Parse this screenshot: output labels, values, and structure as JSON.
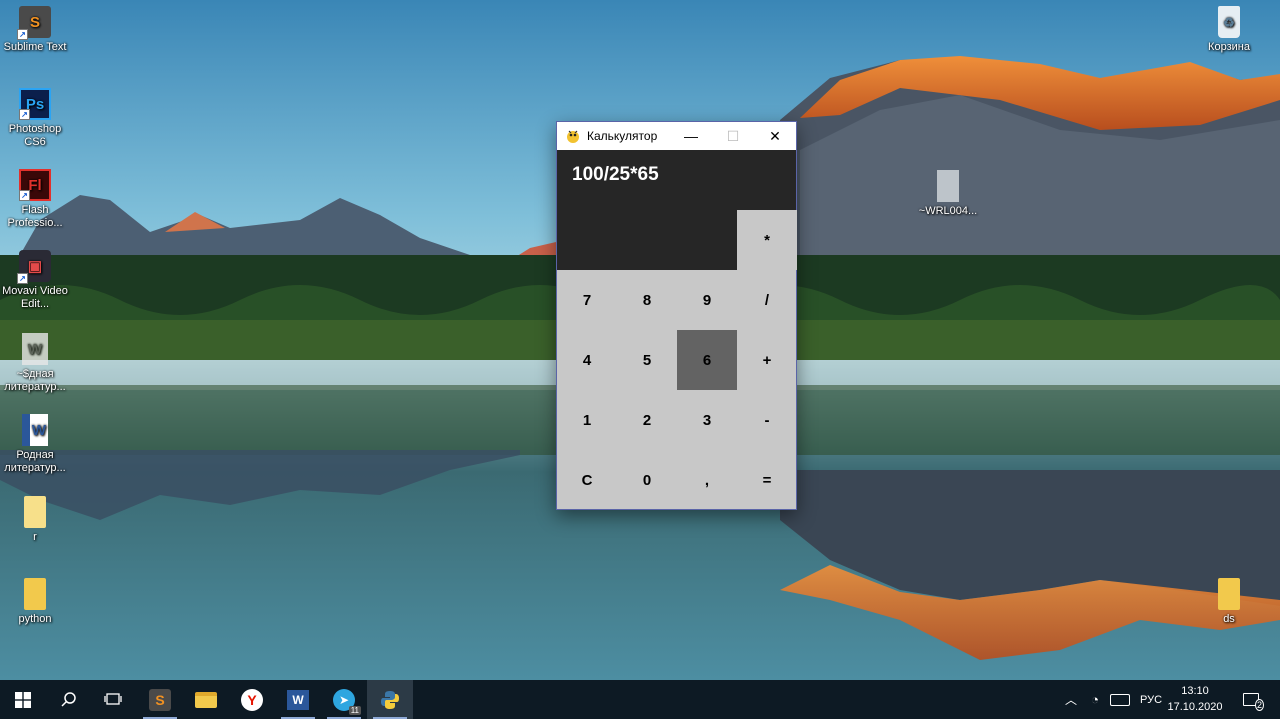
{
  "desktop": {
    "icons": [
      {
        "label": "Sublime Text",
        "icon": "sublime-text-icon"
      },
      {
        "label": "Photoshop CS6",
        "icon": "photoshop-icon",
        "glyph": "Ps"
      },
      {
        "label": "Flash Professio...",
        "icon": "flash-icon",
        "glyph": "Fl"
      },
      {
        "label": "Movavi Video Edit...",
        "icon": "movavi-icon"
      },
      {
        "label": "~$дная литератур...",
        "icon": "word-temp-file-icon"
      },
      {
        "label": "Родная литератур...",
        "icon": "word-document-icon"
      },
      {
        "label": "r",
        "icon": "folder-icon"
      },
      {
        "label": "python",
        "icon": "folder-icon"
      },
      {
        "label": "Корзина",
        "icon": "recycle-bin-icon"
      },
      {
        "label": "~WRL004...",
        "icon": "file-icon"
      },
      {
        "label": "ds",
        "icon": "folder-icon"
      }
    ]
  },
  "calculator": {
    "title": "Калькулятор",
    "expression": "100/25*65",
    "controls": {
      "minimize": "—",
      "maximize": "☐",
      "close": "✕"
    },
    "operator_top": "*",
    "rows": [
      [
        "7",
        "8",
        "9",
        "/"
      ],
      [
        "4",
        "5",
        "6",
        "+"
      ],
      [
        "1",
        "2",
        "3",
        "-"
      ],
      [
        "C",
        "0",
        ",",
        "="
      ]
    ],
    "hovered_key": "6"
  },
  "taskbar": {
    "pinned": [
      "start-icon",
      "search-icon",
      "task-view-icon",
      "sublime-text-icon",
      "file-explorer-icon",
      "yandex-browser-icon",
      "word-icon",
      "telegram-icon",
      "python-icon"
    ],
    "telegram_badge": "11",
    "language": "РУС",
    "time": "13:10",
    "date": "17.10.2020",
    "notifications": "2"
  },
  "colors": {
    "window_border": "#5a64a8",
    "display_bg": "#262626",
    "keypad_bg": "#c8c8c8",
    "key_hover": "#636363",
    "taskbar_bg": "#0d1a24"
  }
}
